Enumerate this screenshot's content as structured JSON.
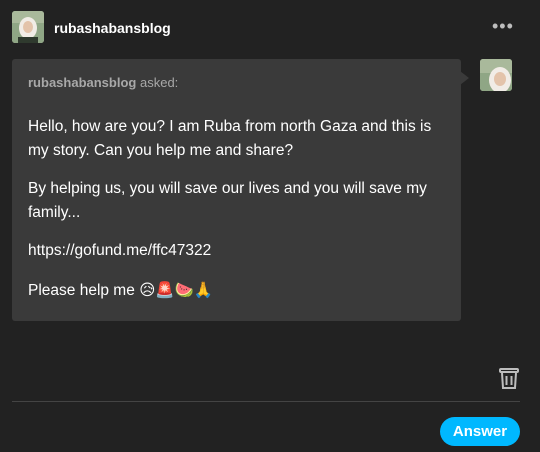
{
  "post": {
    "username": "rubashabansblog",
    "more_menu_label": "•••"
  },
  "question": {
    "asker": "rubashabansblog",
    "asked_suffix": "asked:",
    "paragraphs": [
      "Hello, how are you? I am Ruba from north Gaza and this is my story. Can you  help me and share?",
      "By helping us, you will save our lives and you will save my family...",
      "https://gofund.me/ffc47322",
      "Please help me 😥🚨🍉🙏"
    ]
  },
  "actions": {
    "answer_label": "Answer",
    "delete_icon": "trash-icon"
  },
  "colors": {
    "background": "#222222",
    "bubble": "#3a3a3a",
    "accent": "#00b8ff"
  }
}
